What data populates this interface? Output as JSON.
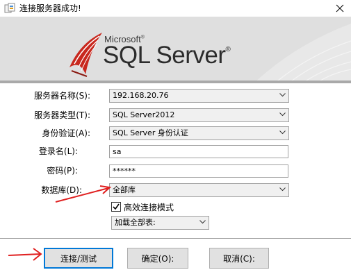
{
  "window": {
    "title": "连接服务器成功!"
  },
  "banner": {
    "vendor": "Microsoft",
    "product": "SQL Server",
    "mark": "®"
  },
  "form": {
    "server_name_label": "服务器名称(S):",
    "server_name_value": "192.168.20.76",
    "server_type_label": "服务器类型(T):",
    "server_type_value": "SQL Server2012",
    "auth_label": "身份验证(A):",
    "auth_value": "SQL Server 身份认证",
    "login_label": "登录名(L):",
    "login_value": "sa",
    "password_label": "密码(P):",
    "password_value": "******",
    "database_label": "数据库(D):",
    "database_value": "全部库",
    "efficient_label": "高效连接模式",
    "efficient_checked": true,
    "load_value": "加载全部表:"
  },
  "buttons": {
    "connect": "连接/测试",
    "ok": "确定(O):",
    "cancel": "取消(C):"
  },
  "colors": {
    "accent": "#0078d7",
    "arrow": "#e02020",
    "logo_red": "#c8281e"
  }
}
